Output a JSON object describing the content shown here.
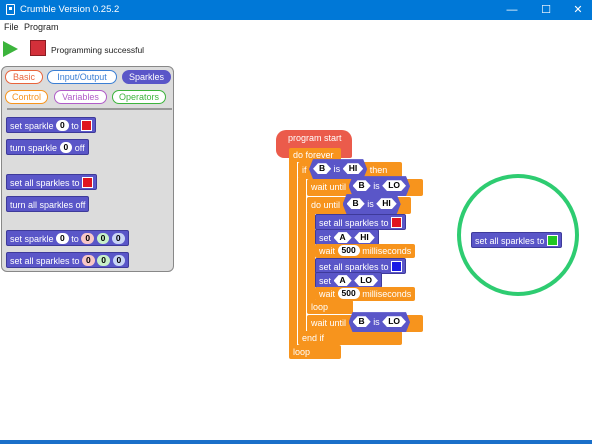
{
  "window": {
    "title": "Crumble Version 0.25.2",
    "minimize": "—",
    "maximize": "☐",
    "close": "✕"
  },
  "menu": {
    "file": "File",
    "program": "Program"
  },
  "toolbar": {
    "status": "Programming successful"
  },
  "categories": [
    {
      "label": "Basic",
      "color": "#e8643c",
      "active": false
    },
    {
      "label": "Input/Output",
      "color": "#3b7fd4",
      "active": false
    },
    {
      "label": "Sparkles",
      "color": "#5a56c8",
      "active": true
    },
    {
      "label": "Control",
      "color": "#f7941d",
      "active": false
    },
    {
      "label": "Variables",
      "color": "#b05cc8",
      "active": false
    },
    {
      "label": "Operators",
      "color": "#3cb43c",
      "active": false
    }
  ],
  "palette": {
    "set_sparkle": {
      "t1": "set sparkle",
      "n": "0",
      "t2": "to"
    },
    "turn_sparkle": {
      "t1": "turn sparkle",
      "n": "0",
      "t2": "off"
    },
    "set_all": {
      "t1": "set all sparkles to"
    },
    "turn_all": {
      "t1": "turn all sparkles off"
    },
    "set_sparkle_rgb": {
      "t1": "set sparkle",
      "n": "0",
      "t2": "to",
      "r": "0",
      "g": "0",
      "b": "0"
    },
    "set_all_rgb": {
      "t1": "set all sparkles to",
      "r": "0",
      "g": "0",
      "b": "0"
    }
  },
  "program": {
    "start": "program start",
    "do_forever": "do forever",
    "if": "if",
    "then": "then",
    "is": "is",
    "B": "B",
    "A": "A",
    "HI": "HI",
    "LO": "LO",
    "wait_until": "wait until",
    "do_until": "do until",
    "set_all": "set all sparkles to",
    "set": "set",
    "wait": "wait",
    "ms": "milliseconds",
    "ms_value": "500",
    "loop": "loop",
    "end_if": "end if"
  },
  "floating_block": {
    "label": "set all sparkles to"
  },
  "colors": {
    "red": "#e0141e",
    "blue": "#1a1ae6",
    "green": "#22c722",
    "highlight": "#2ecc71"
  }
}
